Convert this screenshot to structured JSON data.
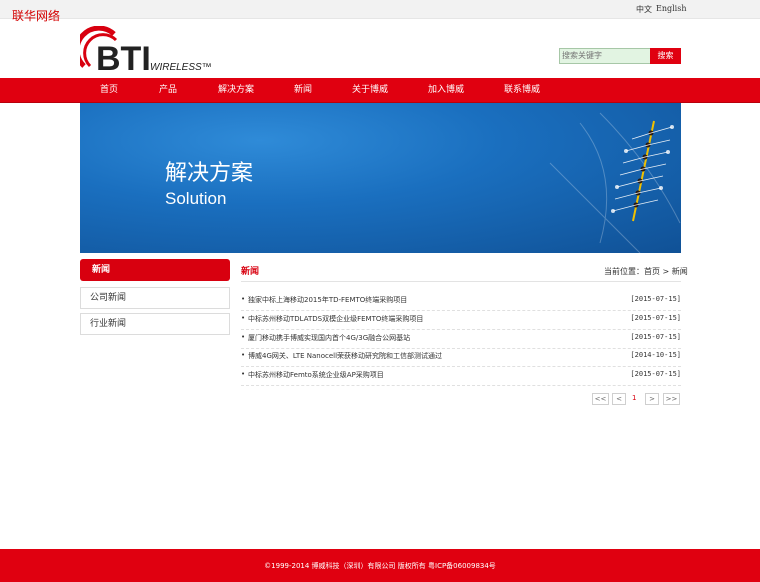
{
  "watermark": "联华网络",
  "topbar": {
    "lang_zh": "中文",
    "lang_en": "English"
  },
  "logo": {
    "text": "BTI",
    "subtext": "WIRELESS™"
  },
  "search": {
    "placeholder": "搜索关键字",
    "button": "搜索"
  },
  "nav": [
    "首页",
    "产品",
    "解决方案",
    "新闻",
    "关于博威",
    "加入博威",
    "联系博威"
  ],
  "banner": {
    "title_cn": "解决方案",
    "title_en": "Solution"
  },
  "sidebar": {
    "title": "新闻",
    "items": [
      "公司新闻",
      "行业新闻"
    ]
  },
  "section": {
    "title": "新闻",
    "breadcrumb": "当前位置：首页 > 新闻"
  },
  "news": [
    {
      "title": "独家中标上海移动2015年TD-FEMTO终端采购项目",
      "date": "[2015-07-15]"
    },
    {
      "title": "中标苏州移动TDLATDS双模企业级FEMTO终端采购项目",
      "date": "[2015-07-15]"
    },
    {
      "title": "厦门移动携手博威实现国内首个4G/3G融合公网基站",
      "date": "[2015-07-15]"
    },
    {
      "title": "博威4G网关、LTE Nanocell荣获移动研究院和工信部测试通过",
      "date": "[2014-10-15]"
    },
    {
      "title": "中标苏州移动Femto系统企业级AP采购项目",
      "date": "[2015-07-15]"
    }
  ],
  "pager": {
    "first": "<<",
    "prev": "<",
    "current": "1",
    "next": ">",
    "last": ">>"
  },
  "footer": {
    "text": "©1999-2014 博威科技（深圳）有限公司 版权所有 粤ICP备06009834号"
  },
  "colors": {
    "brand_red": "#e00010",
    "banner_blue": "#1a6fbf"
  }
}
